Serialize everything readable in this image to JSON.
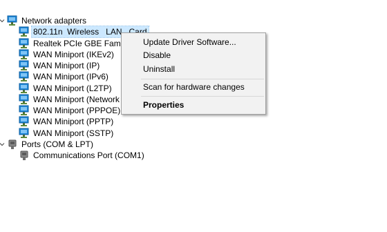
{
  "tree": {
    "network_adapters": {
      "label": "Network adapters",
      "items": [
        "802.11n  Wireless   LAN   Card",
        "Realtek PCIe GBE Family Co",
        "WAN Miniport (IKEv2)",
        "WAN Miniport (IP)",
        "WAN Miniport (IPv6)",
        "WAN Miniport (L2TP)",
        "WAN Miniport (Network M",
        "WAN Miniport (PPPOE)",
        "WAN Miniport (PPTP)",
        "WAN Miniport (SSTP)"
      ]
    },
    "ports": {
      "label": "Ports (COM & LPT)",
      "items": [
        "Communications Port (COM1)"
      ]
    }
  },
  "context_menu": {
    "update_driver": "Update Driver Software...",
    "disable": "Disable",
    "uninstall": "Uninstall",
    "scan": "Scan for hardware changes",
    "properties": "Properties"
  },
  "colors": {
    "selection": "#cce8ff",
    "menu_background": "#f2f2f2",
    "icon_monitor": "#1e86d6"
  }
}
